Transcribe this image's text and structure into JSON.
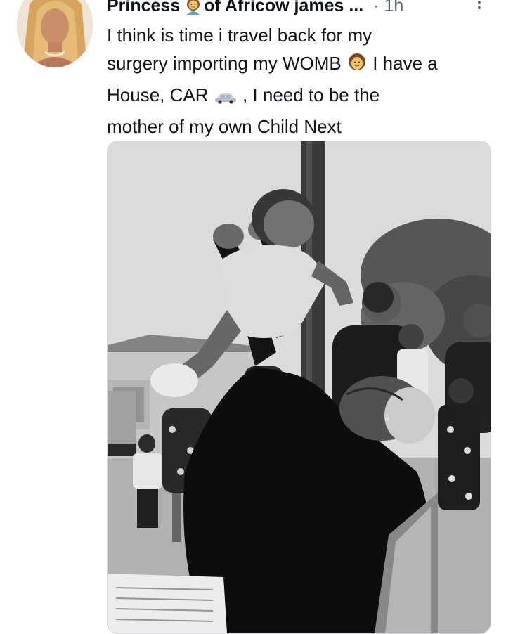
{
  "tweet": {
    "author": {
      "display_name_part1": "Princess",
      "display_name_part2": "of Africow james ...",
      "name_emoji": "woman-icon"
    },
    "meta": {
      "separator": "·",
      "timestamp": "1h"
    },
    "more_icon": "more-vertical-icon",
    "text": {
      "line1": "I think is time i travel back for my",
      "line2_a": "surgery importing my WOMB",
      "line2_emoji": "woman-icon",
      "line2_b": "I have a",
      "line3_a": "House, CAR",
      "line3_emoji": "car-icon",
      "line3_b": ", I need to be the",
      "line4": "mother of my own Child Next"
    },
    "media": {
      "type": "photo",
      "tone": "black-and-white"
    }
  }
}
